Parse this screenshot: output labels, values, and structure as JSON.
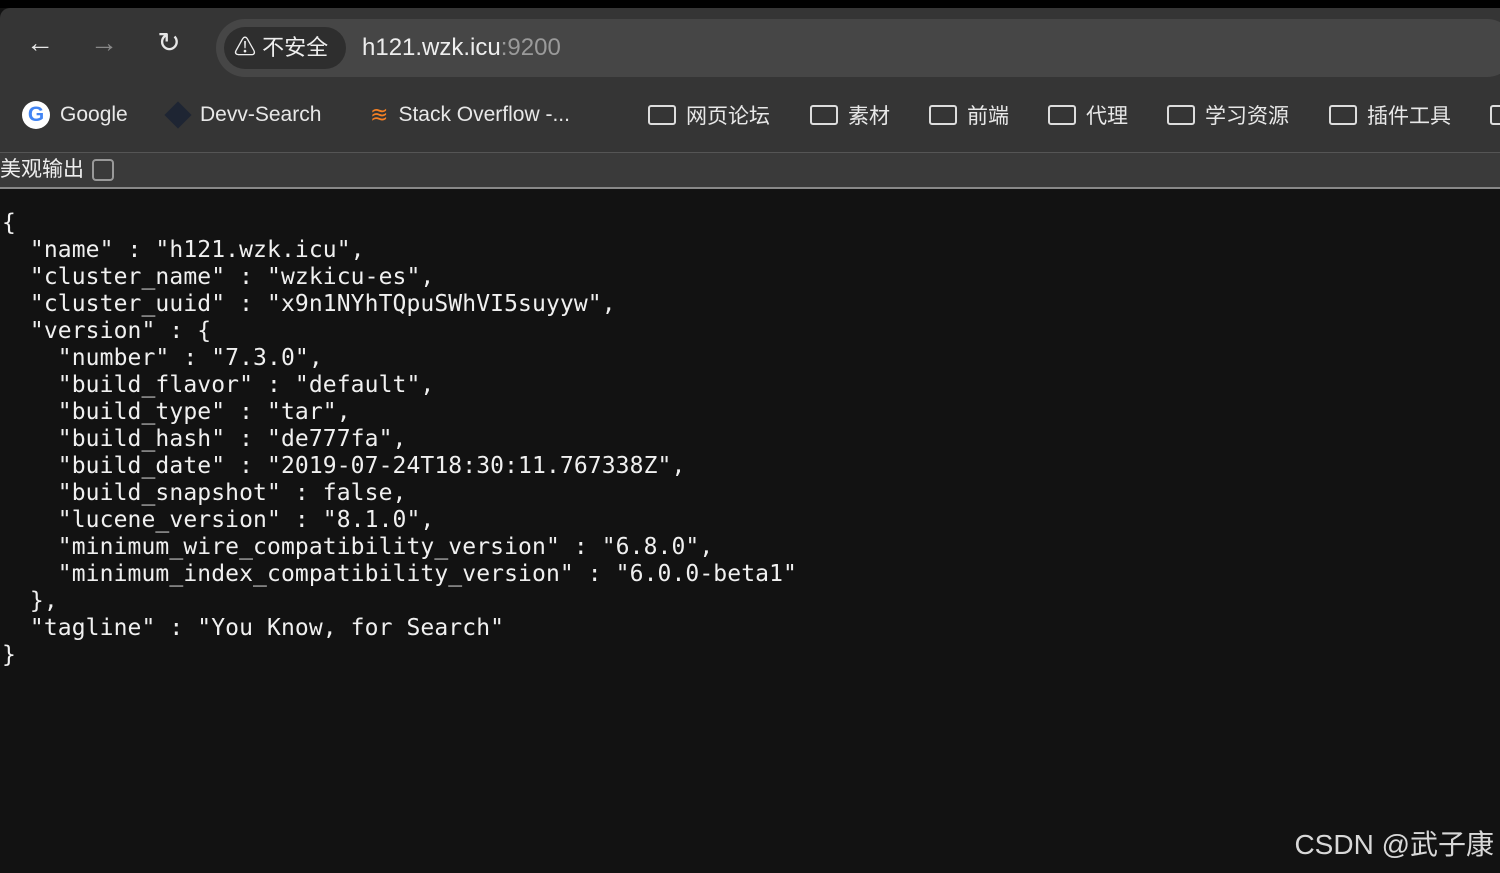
{
  "browser": {
    "security_label": "不安全",
    "url_host": "h121.wzk.icu",
    "url_port": ":9200",
    "bookmarks": [
      "Google",
      "Devv-Search",
      "Stack Overflow -...",
      "网页论坛",
      "素材",
      "前端",
      "代理",
      "学习资源",
      "插件工具"
    ]
  },
  "toolbar": {
    "pretty_print_label": "美观输出"
  },
  "json_lines": [
    "{",
    "  \"name\" : \"h121.wzk.icu\",",
    "  \"cluster_name\" : \"wzkicu-es\",",
    "  \"cluster_uuid\" : \"x9n1NYhTQpuSWhVI5suyyw\",",
    "  \"version\" : {",
    "    \"number\" : \"7.3.0\",",
    "    \"build_flavor\" : \"default\",",
    "    \"build_type\" : \"tar\",",
    "    \"build_hash\" : \"de777fa\",",
    "    \"build_date\" : \"2019-07-24T18:30:11.767338Z\",",
    "    \"build_snapshot\" : false,",
    "    \"lucene_version\" : \"8.1.0\",",
    "    \"minimum_wire_compatibility_version\" : \"6.8.0\",",
    "    \"minimum_index_compatibility_version\" : \"6.0.0-beta1\"",
    "  },",
    "  \"tagline\" : \"You Know, for Search\"",
    "}"
  ],
  "watermark": "CSDN @武子康"
}
